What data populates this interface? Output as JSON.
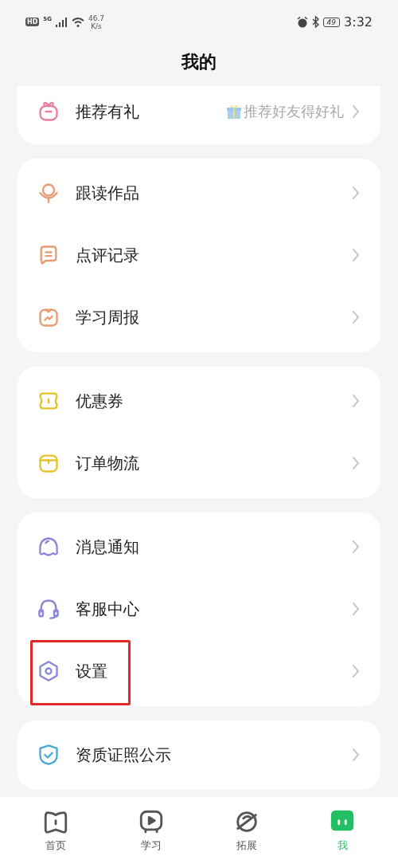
{
  "status_bar": {
    "network_badge": "HD",
    "signal_type": "5G",
    "speed_value": "46.7",
    "speed_unit": "K/s",
    "battery": "49",
    "time": "3:32"
  },
  "header": {
    "title": "我的"
  },
  "cards": [
    {
      "rows": [
        {
          "label": "推荐有礼",
          "hint": "推荐好友得好礼",
          "highlighted": false
        }
      ]
    },
    {
      "rows": [
        {
          "label": "跟读作品",
          "highlighted": false
        },
        {
          "label": "点评记录",
          "highlighted": false
        },
        {
          "label": "学习周报",
          "highlighted": false
        }
      ]
    },
    {
      "rows": [
        {
          "label": "优惠券",
          "highlighted": false
        },
        {
          "label": "订单物流",
          "highlighted": false
        }
      ]
    },
    {
      "rows": [
        {
          "label": "消息通知",
          "highlighted": false
        },
        {
          "label": "客服中心",
          "highlighted": false
        },
        {
          "label": "设置",
          "highlighted": true
        }
      ]
    },
    {
      "rows": [
        {
          "label": "资质证照公示",
          "highlighted": false
        }
      ]
    }
  ],
  "tab_bar": [
    {
      "label": "首页",
      "selected": false
    },
    {
      "label": "学习",
      "selected": false
    },
    {
      "label": "拓展",
      "selected": false
    },
    {
      "label": "我",
      "selected": true
    }
  ]
}
